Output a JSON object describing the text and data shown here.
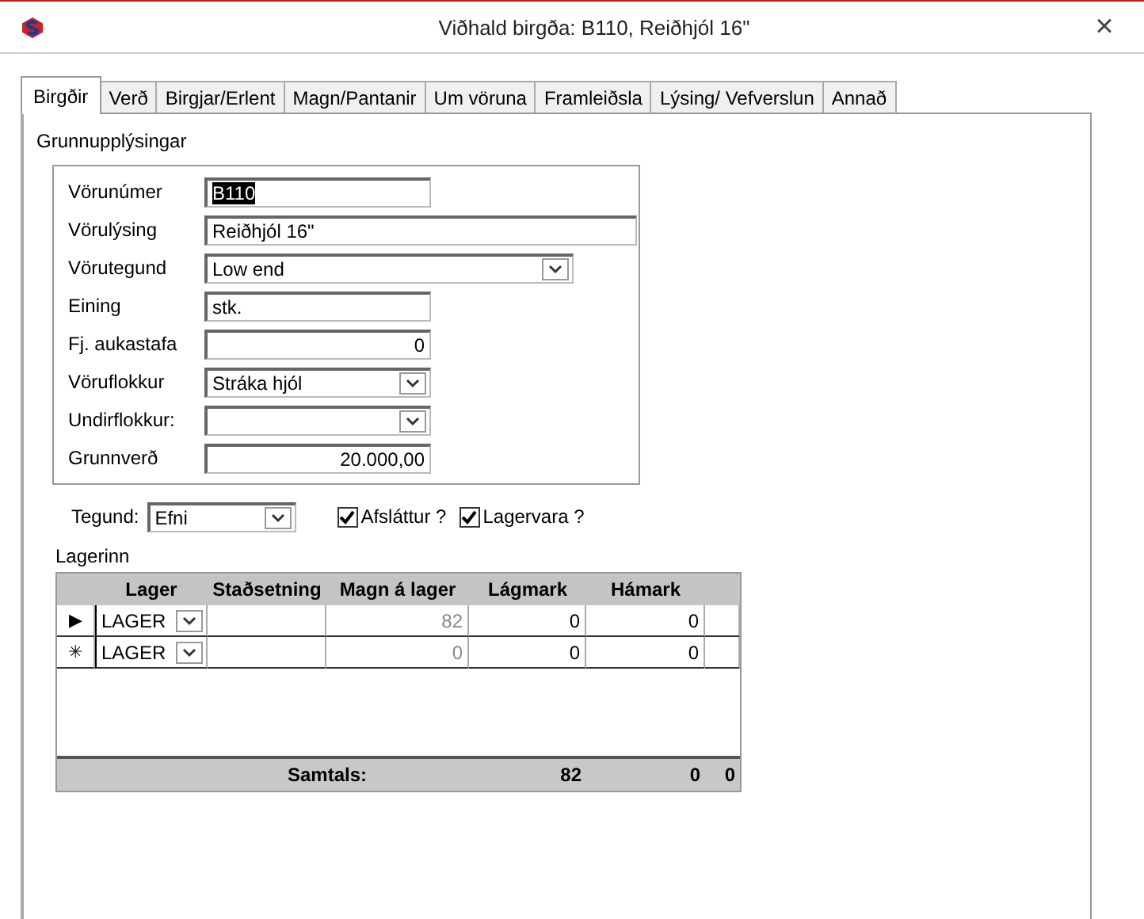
{
  "window": {
    "title": "Viðhald birgða: B110, Reiðhjól 16\"",
    "close": "×"
  },
  "tabs": [
    {
      "label": "Birgðir",
      "selected": true
    },
    {
      "label": "Verð",
      "selected": false
    },
    {
      "label": "Birgjar/Erlent",
      "selected": false
    },
    {
      "label": "Magn/Pantanir",
      "selected": false
    },
    {
      "label": "Um vöruna",
      "selected": false
    },
    {
      "label": "Framleiðsla",
      "selected": false
    },
    {
      "label": "Lýsing/ Vefverslun",
      "selected": false
    },
    {
      "label": "Annað",
      "selected": false
    }
  ],
  "basic_info": {
    "title": "Grunnupplýsingar",
    "fields": [
      {
        "label": "Vörunúmer",
        "value": "B110",
        "kind": "text",
        "highlighted": true
      },
      {
        "label": "Vörulýsing",
        "value": "Reiðhjól 16\"",
        "kind": "longtext"
      },
      {
        "label": "Vörutegund",
        "value": "Low end",
        "kind": "widecombo"
      },
      {
        "label": "Eining",
        "value": "stk.",
        "kind": "text"
      },
      {
        "label": "Fj. aukastafa",
        "value": "0",
        "kind": "number"
      },
      {
        "label": "Vöruflokkur",
        "value": "Stráka hjól",
        "kind": "combo"
      },
      {
        "label": "Undirflokkur:",
        "kind": "combo"
      },
      {
        "label": "Grunnverð",
        "value": "20.000,00",
        "kind": "number"
      }
    ]
  },
  "type_field": {
    "label": "Tegund:",
    "value": "Efni"
  },
  "checkboxes": [
    {
      "label": "Afsláttur ?",
      "checked": true
    },
    {
      "label": "Lagervara ?",
      "checked": true
    }
  ],
  "stock": {
    "title": "Lagerinn",
    "columns": [
      {
        "label": "Lager",
        "disabled": false
      },
      {
        "label": "Staðsetning",
        "disabled": false
      },
      {
        "label": "Magn á lager",
        "disabled": true
      },
      {
        "label": "Lágmark",
        "disabled": false
      },
      {
        "label": "Hámark",
        "disabled": false
      }
    ],
    "rows": [
      {
        "indicator": "▶",
        "cells": [
          "LAGER",
          null,
          "82",
          "0",
          "0"
        ]
      },
      {
        "indicator": "✳",
        "cells": [
          "LAGER",
          null,
          "0",
          "0",
          "0"
        ]
      }
    ],
    "totals": {
      "label": "Samtals:",
      "values": [
        "82",
        "0",
        "0"
      ]
    }
  }
}
